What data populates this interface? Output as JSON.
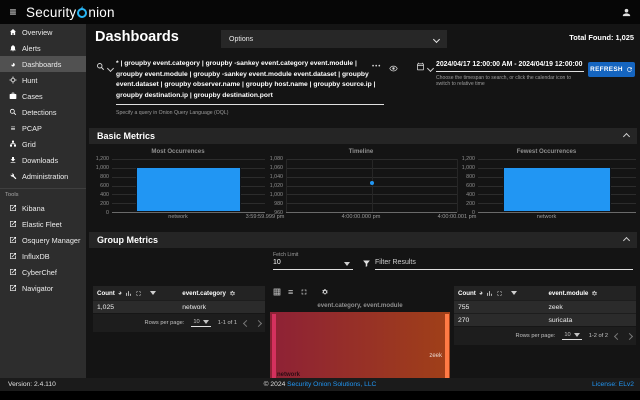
{
  "colors": {
    "accent": "#2196f3",
    "refresh_button": "#1565c0",
    "link": "#2196f3",
    "sankey_left_node": "#d4315e",
    "sankey_right_node": "#ff7a45",
    "sankey_gradient_start": "#8e2136",
    "sankey_gradient_end": "#a04018"
  },
  "topbar": {
    "logo": {
      "text": "Security Onion",
      "prefix": "Security",
      "suffix": "nion"
    },
    "icons": [
      "hamburger-icon",
      "user-icon"
    ]
  },
  "sidebar": {
    "items": [
      {
        "label": "Overview",
        "icon": "home"
      },
      {
        "label": "Alerts",
        "icon": "bell"
      },
      {
        "label": "Dashboards",
        "icon": "pie-chart",
        "selected": true
      },
      {
        "label": "Hunt",
        "icon": "crosshair"
      },
      {
        "label": "Cases",
        "icon": "briefcase"
      },
      {
        "label": "Detections",
        "icon": "magnifier"
      },
      {
        "label": "PCAP",
        "icon": "list"
      },
      {
        "label": "Grid",
        "icon": "sitemap"
      },
      {
        "label": "Downloads",
        "icon": "download"
      },
      {
        "label": "Administration",
        "icon": "tools"
      }
    ],
    "tools_label": "Tools",
    "tools": [
      {
        "label": "Kibana",
        "icon": "external-link"
      },
      {
        "label": "Elastic Fleet",
        "icon": "external-link"
      },
      {
        "label": "Osquery Manager",
        "icon": "external-link"
      },
      {
        "label": "InfluxDB",
        "icon": "external-link"
      },
      {
        "label": "CyberChef",
        "icon": "external-link"
      },
      {
        "label": "Navigator",
        "icon": "external-link"
      }
    ]
  },
  "header": {
    "page_title": "Dashboards",
    "options_label": "Options",
    "total_found": "Total Found: 1,025"
  },
  "search": {
    "query": "* | groupby event.category | groupby -sankey event.category event.module | groupby event.module | groupby -sankey event.module event.dataset | groupby event.dataset | groupby observer.name | groupby host.name | groupby source.ip | groupby destination.ip | groupby destination.port",
    "query_hint": "Specify a query in Onion Query Language (OQL)",
    "more_icon": "•••",
    "date_range": "2024/04/17 12:00:00 AM - 2024/04/19 12:00:00",
    "date_hint": "Choose the timespan to search, or click the calendar icon to switch to relative time",
    "refresh_label": "REFRESH"
  },
  "basic_metrics": {
    "title": "Basic Metrics"
  },
  "group_metrics": {
    "title": "Group Metrics",
    "fetch_limit_label": "Fetch Limit",
    "fetch_limit_value": "10",
    "filter_placeholder": "Filter Results",
    "tables": [
      {
        "count_header": "Count",
        "field_header": "event.category",
        "rows": [
          {
            "count": "1,025",
            "value": "network"
          }
        ],
        "footer": {
          "rows_per_page_label": "Rows per page:",
          "rows_per_page_value": "10",
          "range": "1-1 of 1"
        }
      },
      {
        "count_header": "Count",
        "field_header": "event.module",
        "rows": [
          {
            "count": "755",
            "value": "zeek"
          },
          {
            "count": "270",
            "value": "suricata"
          }
        ],
        "footer": {
          "rows_per_page_label": "Rows per page:",
          "rows_per_page_value": "10",
          "range": "1-2 of 2"
        }
      }
    ],
    "sankey": {
      "title": "event.category, event.module",
      "left_label": "network",
      "right_label": "zeek"
    }
  },
  "footer": {
    "version": "Version: 2.4.110",
    "copyright_prefix": "© 2024 ",
    "copyright_link": "Security Onion Solutions, LLC",
    "license": "License: ELv2"
  },
  "chart_data": [
    {
      "type": "bar",
      "title": "Most Occurrences",
      "categories": [
        "network"
      ],
      "values": [
        1025
      ],
      "ylim": [
        0,
        1200
      ],
      "yticks": [
        "1,200",
        "1,000",
        "800",
        "600",
        "400",
        "200",
        "0"
      ],
      "grid": true,
      "bar_color": "#2196f3"
    },
    {
      "type": "scatter",
      "title": "Timeline",
      "x": [
        "3:59:59.999 pm",
        "4:00:00.000 pm",
        "4:00:00.001 pm"
      ],
      "points": [
        {
          "x_index": 1,
          "x_label": "4:00:00.000 pm",
          "y": 1025
        }
      ],
      "ylim": [
        960,
        1080
      ],
      "yticks": [
        "1,080",
        "1,060",
        "1,040",
        "1,020",
        "1,000",
        "980",
        "960"
      ],
      "grid": true,
      "point_color": "#2196f3"
    },
    {
      "type": "bar",
      "title": "Fewest Occurrences",
      "categories": [
        "network"
      ],
      "values": [
        1025
      ],
      "ylim": [
        0,
        1200
      ],
      "yticks": [
        "1,200",
        "1,000",
        "800",
        "600",
        "400",
        "200",
        "0"
      ],
      "grid": true,
      "bar_color": "#2196f3"
    },
    {
      "type": "sankey",
      "title": "event.category, event.module",
      "flows": [
        {
          "source": "network",
          "target": "zeek",
          "value": 755
        },
        {
          "source": "network",
          "target": "suricata",
          "value": 270
        }
      ],
      "visible_labels": [
        "network",
        "zeek"
      ]
    }
  ]
}
